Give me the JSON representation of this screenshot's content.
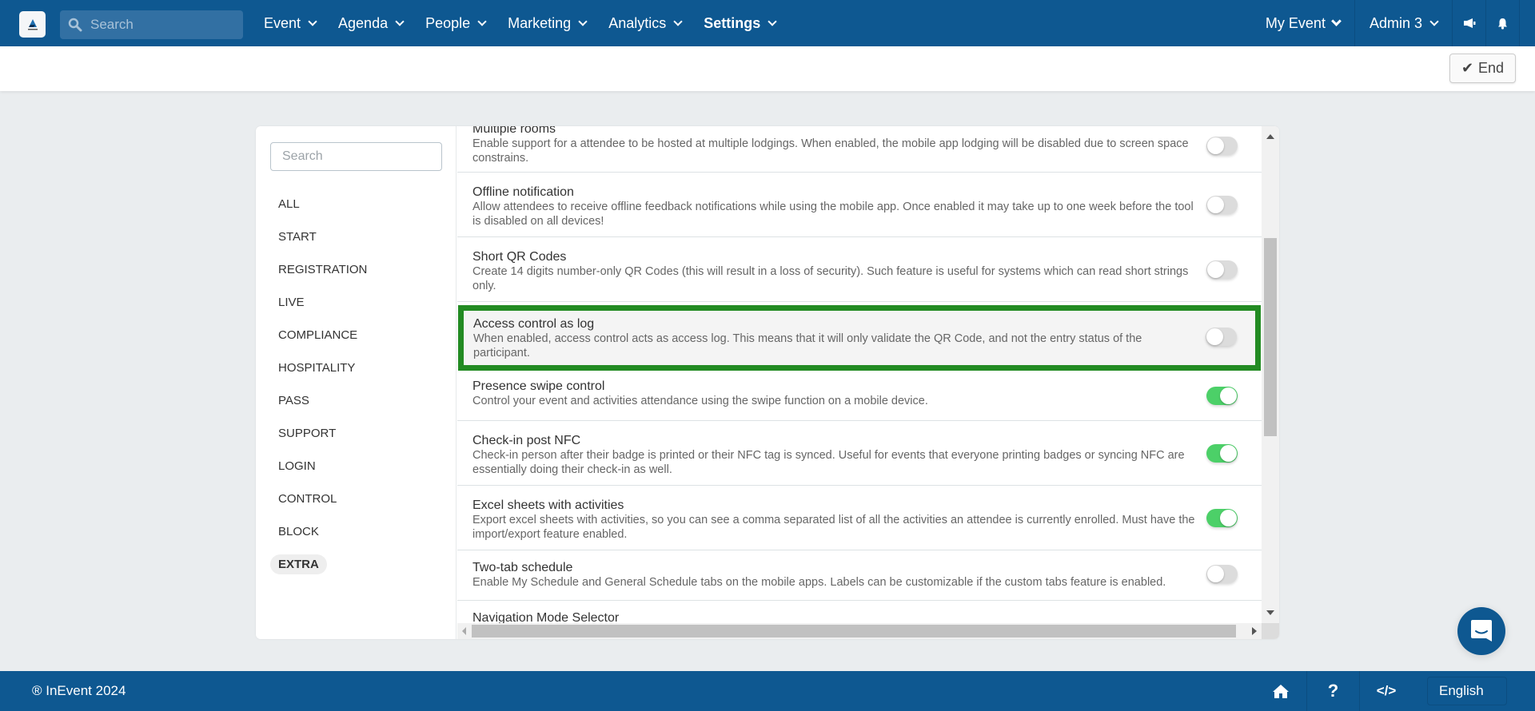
{
  "topnav": {
    "logo": "inevent-logo-icon",
    "search_placeholder": "Search",
    "menu": [
      {
        "label": "Event",
        "bold": false
      },
      {
        "label": "Agenda",
        "bold": false
      },
      {
        "label": "People",
        "bold": false
      },
      {
        "label": "Marketing",
        "bold": false
      },
      {
        "label": "Analytics",
        "bold": false
      },
      {
        "label": "Settings",
        "bold": true
      }
    ],
    "event_selector": "My Event",
    "user_menu": "Admin 3",
    "icons": [
      "megaphone-icon",
      "bell-icon"
    ]
  },
  "subheader": {
    "end_button": "End",
    "end_icon": "check-icon"
  },
  "leftnav": {
    "search_placeholder": "Search",
    "items": [
      {
        "label": "ALL"
      },
      {
        "label": "START"
      },
      {
        "label": "REGISTRATION"
      },
      {
        "label": "LIVE"
      },
      {
        "label": "COMPLIANCE"
      },
      {
        "label": "HOSPITALITY"
      },
      {
        "label": "PASS"
      },
      {
        "label": "SUPPORT"
      },
      {
        "label": "LOGIN"
      },
      {
        "label": "CONTROL"
      },
      {
        "label": "BLOCK"
      },
      {
        "label": "EXTRA"
      }
    ],
    "active": "EXTRA"
  },
  "features": [
    {
      "title": "Multiple rooms",
      "description": "Enable support for a attendee to be hosted at multiple lodgings. When enabled, the mobile app lodging will be disabled due to screen space constrains.",
      "enabled": false
    },
    {
      "title": "Offline notification",
      "description": "Allow attendees to receive offline feedback notifications while using the mobile app. Once enabled it may take up to one week before the tool is disabled on all devices!",
      "enabled": false
    },
    {
      "title": "Short QR Codes",
      "description": "Create 14 digits number-only QR Codes (this will result in a loss of security). Such feature is useful for systems which can read short strings only.",
      "enabled": false
    },
    {
      "title": "Access control as log",
      "description": "When enabled, access control acts as access log. This means that it will only validate the QR Code, and not the entry status of the participant.",
      "enabled": false,
      "highlighted": true
    },
    {
      "title": "Presence swipe control",
      "description": "Control your event and activities attendance using the swipe function on a mobile device.",
      "enabled": true
    },
    {
      "title": "Check-in post NFC",
      "description": "Check-in person after their badge is printed or their NFC tag is synced. Useful for events that everyone printing badges or syncing NFC are essentially doing their check-in as well.",
      "enabled": true
    },
    {
      "title": "Excel sheets with activities",
      "description": "Export excel sheets with activities, so you can see a comma separated list of all the activities an attendee is currently enrolled. Must have the import/export feature enabled.",
      "enabled": true
    },
    {
      "title": "Two-tab schedule",
      "description": "Enable My Schedule and General Schedule tabs on the mobile apps. Labels can be customizable if the custom tabs feature is enabled.",
      "enabled": false
    },
    {
      "title": "Navigation Mode Selector",
      "description": "",
      "enabled": null
    }
  ],
  "footer": {
    "copyright": "® InEvent 2024",
    "icons": [
      "home-icon",
      "help-icon",
      "code-icon"
    ],
    "language": "English"
  },
  "colors": {
    "brand": "#0e5891",
    "highlight_border": "#228b22",
    "toggle_on": "#4cd068",
    "toggle_off": "#dcdcdc"
  }
}
